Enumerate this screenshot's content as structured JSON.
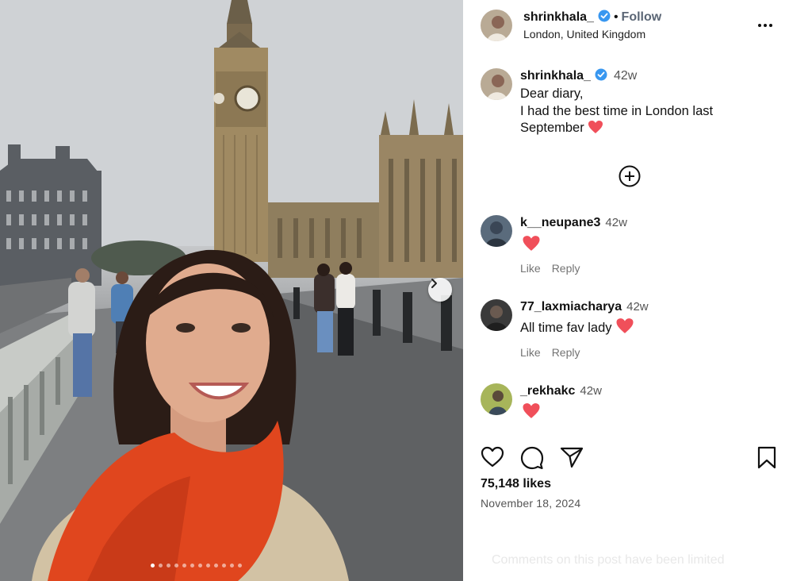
{
  "post": {
    "author": "shrinkhala_",
    "follow_label": "Follow",
    "location": "London, United Kingdom",
    "more_icon": "more-horizontal-icon",
    "verified_color": "#3897f0",
    "carousel": {
      "slide_count": 12,
      "active_slide": 1,
      "next_icon": "chevron-right-icon"
    }
  },
  "caption": {
    "author": "shrinkhala_",
    "time": "42w",
    "lines": [
      "Dear diary,",
      "I had the best time in London last",
      "September"
    ],
    "emoji": "red-heart"
  },
  "load_more_icon": "plus-circle-icon",
  "comments": [
    {
      "author": "k__neupane3",
      "time": "42w",
      "text": "",
      "emoji": "red-heart",
      "like": "Like",
      "reply": "Reply"
    },
    {
      "author": "77_laxmiacharya",
      "time": "42w",
      "text": "All time fav lady",
      "emoji": "red-heart",
      "like": "Like",
      "reply": "Reply"
    },
    {
      "author": "_rekhakc",
      "time": "42w",
      "text": "",
      "emoji": "red-heart"
    }
  ],
  "actions": {
    "like_icon": "heart-icon",
    "comment_icon": "comment-icon",
    "share_icon": "send-icon",
    "save_icon": "bookmark-icon"
  },
  "likes": "75,148 likes",
  "date": "November 18, 2024",
  "comments_limited": "Comments on this post have been limited",
  "colors": {
    "heart": "#f04f5a",
    "text": "#111111",
    "muted": "#737373"
  }
}
